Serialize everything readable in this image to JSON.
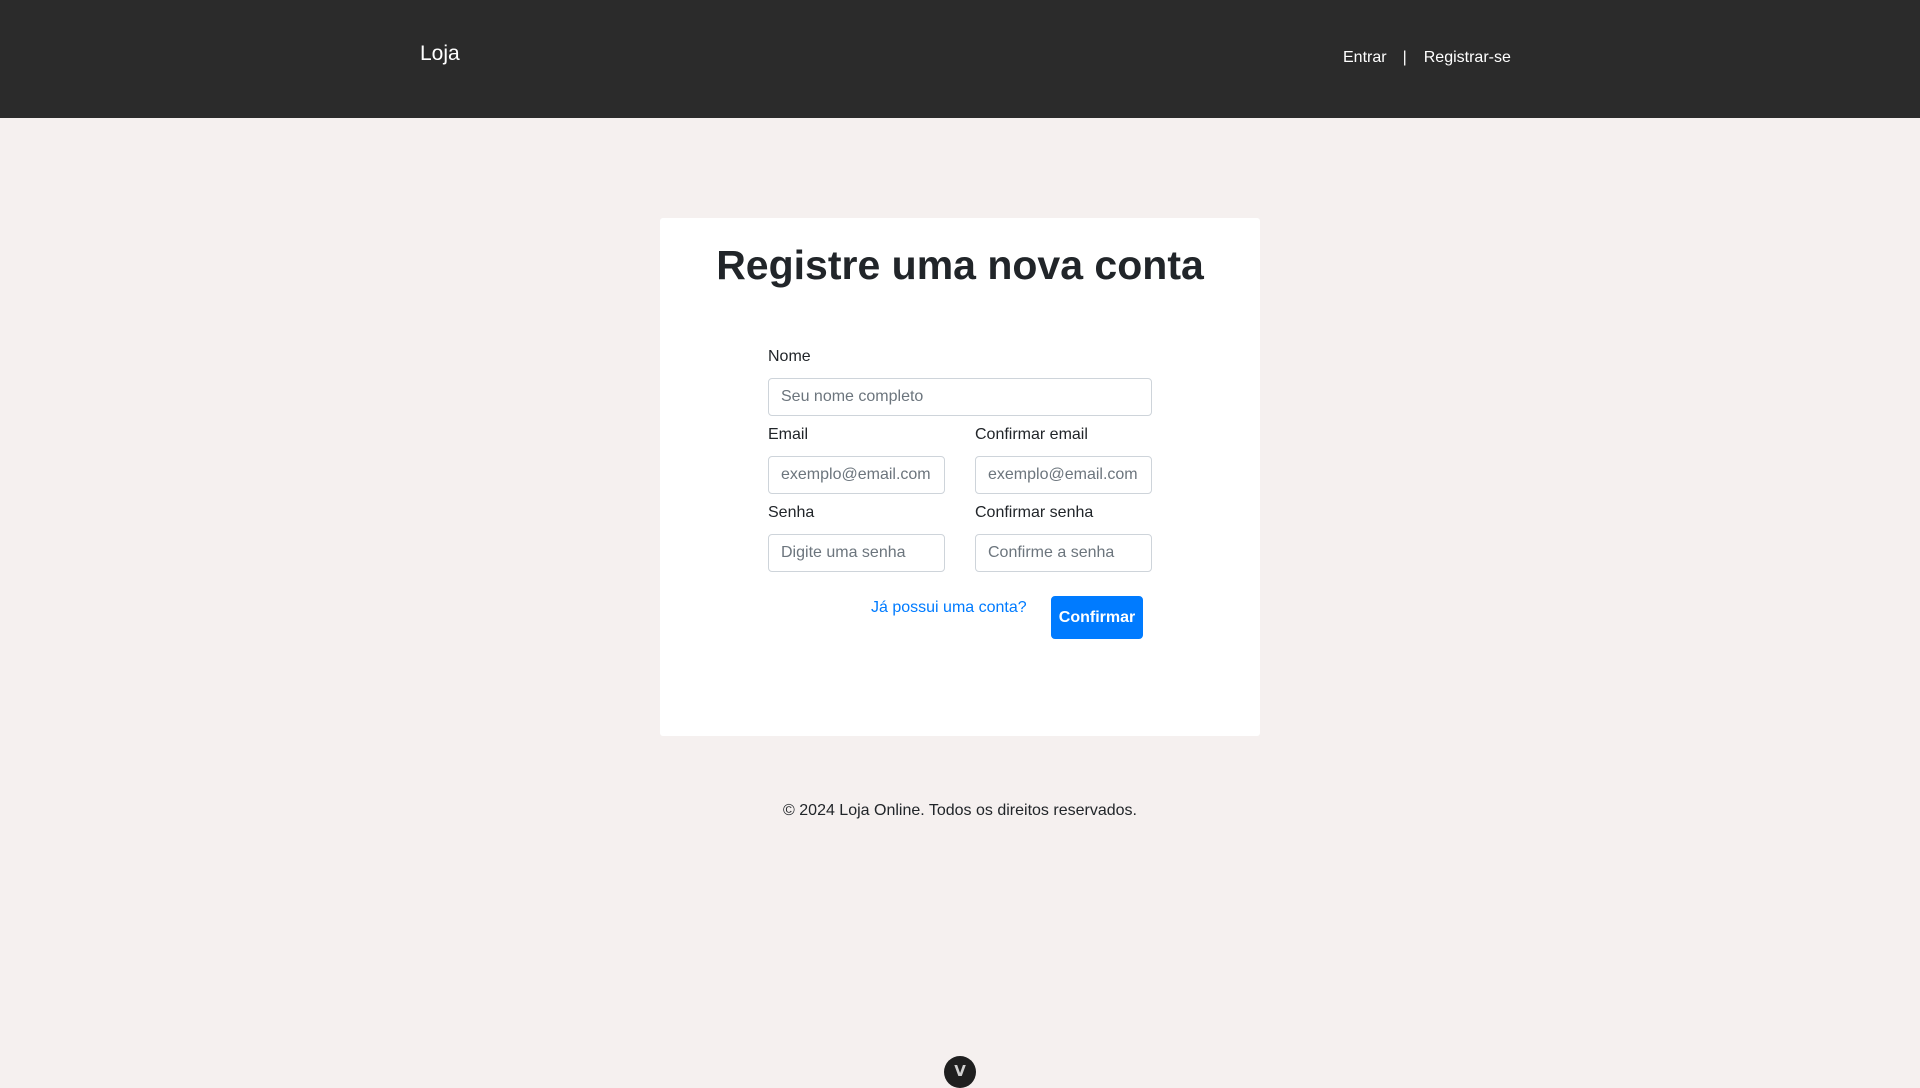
{
  "navbar": {
    "brand": "Loja",
    "login_link": "Entrar",
    "separator": "|",
    "register_link": "Registrar-se"
  },
  "register_form": {
    "title": "Registre uma nova conta",
    "name": {
      "label": "Nome",
      "placeholder": "Seu nome completo",
      "value": ""
    },
    "email": {
      "label": "Email",
      "placeholder": "exemplo@email.com",
      "value": ""
    },
    "confirm_email": {
      "label": "Confirmar email",
      "placeholder": "exemplo@email.com",
      "value": ""
    },
    "password": {
      "label": "Senha",
      "placeholder": "Digite uma senha",
      "value": ""
    },
    "confirm_password": {
      "label": "Confirmar senha",
      "placeholder": "Confirme a senha",
      "value": ""
    },
    "has_account_link": "Já possui uma conta?",
    "submit_label": "Confirmar"
  },
  "footer": {
    "copyright": "© 2024 Loja Online. Todos os direitos reservados."
  },
  "devtools": {
    "toggle_glyph": "V",
    "icon": "vue-devtools-icon"
  },
  "colors": {
    "navbar_bg": "#2b2b2b",
    "page_bg": "#f5f0ef",
    "primary": "#007bff",
    "text": "#212529"
  }
}
